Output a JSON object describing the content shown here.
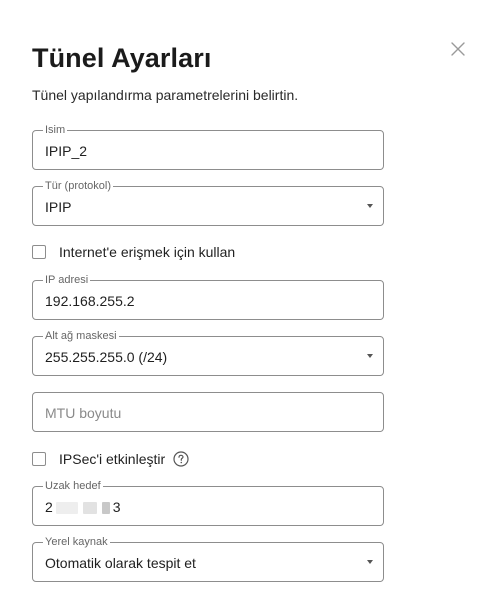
{
  "dialog": {
    "title": "Tünel Ayarları",
    "subtitle": "Tünel yapılandırma parametrelerini belirtin.",
    "close_icon": "close-icon"
  },
  "fields": {
    "name": {
      "label": "Isim",
      "value": "IPIP_2"
    },
    "protocol": {
      "label": "Tür (protokol)",
      "value": "IPIP"
    },
    "ip_address": {
      "label": "IP adresi",
      "value": "192.168.255.2"
    },
    "subnet_mask": {
      "label": "Alt ağ maskesi",
      "value": "255.255.255.0 (/24)"
    },
    "mtu": {
      "placeholder": "MTU boyutu"
    },
    "remote_target": {
      "label": "Uzak hedef",
      "value_start": "2",
      "value_end": "3"
    },
    "local_source": {
      "label": "Yerel kaynak",
      "value": "Otomatik olarak tespit et"
    }
  },
  "checkboxes": {
    "use_for_internet": {
      "label": "Internet'e erişmek için kullan",
      "checked": false
    },
    "enable_ipsec": {
      "label": "IPSec'i etkinleştir",
      "checked": false
    }
  },
  "colors": {
    "border": "#8d8d8d",
    "text": "#1f1f1f",
    "muted": "#666666"
  }
}
